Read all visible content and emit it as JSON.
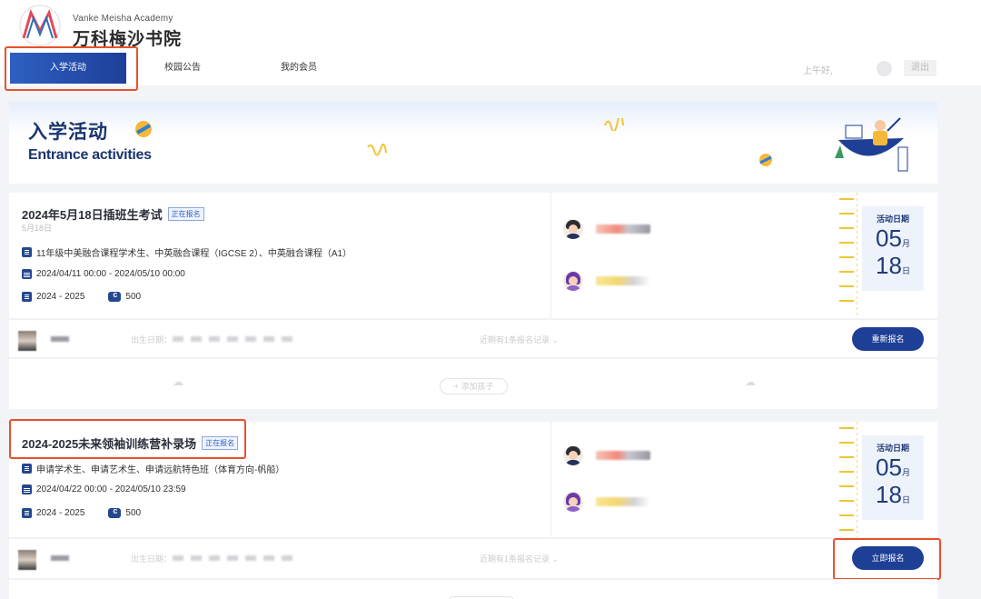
{
  "brand": {
    "en": "Vanke Meisha Academy",
    "cn": "万科梅沙书院"
  },
  "nav": [
    {
      "label": "入学活动",
      "active": true
    },
    {
      "label": "校园公告",
      "active": false
    },
    {
      "label": "我的会员",
      "active": false
    }
  ],
  "header_right": {
    "greeting": "上午好,",
    "logout": "退出"
  },
  "banner": {
    "title_cn": "入学活动",
    "title_en": "Entrance activities"
  },
  "activities": [
    {
      "title": "2024年5月18日插班生考试",
      "status": "正在报名",
      "subtitle": "5月18日",
      "program": "11年级中美融合课程学术生、中英融合课程（IGCSE 2）、中英融合课程（A1）",
      "period": "2024/04/11 00:00 - 2024/05/10 00:00",
      "year": "2024 - 2025",
      "fee": "500",
      "date_label": "活动日期",
      "month": "05",
      "month_unit": "月",
      "day": "18",
      "day_unit": "日",
      "child": {
        "dob_label": "出生日期：",
        "recent": "近期有1条报名记录 ⌄",
        "action": "重新报名"
      },
      "add_child": "+ 添加孩子"
    },
    {
      "title": "2024-2025未来领袖训练营补录场",
      "status": "正在报名",
      "program": "申请学术生、申请艺术生、申请远航特色班（体育方向-帆船）",
      "period": "2024/04/22 00:00 - 2024/05/10 23:59",
      "year": "2024 - 2025",
      "fee": "500",
      "date_label": "活动日期",
      "month": "05",
      "month_unit": "月",
      "day": "18",
      "day_unit": "日",
      "child": {
        "dob_label": "出生日期：",
        "recent": "近期有1条报名记录 ⌄",
        "action": "立即报名"
      }
    }
  ],
  "colors": {
    "primary": "#1e3f96",
    "highlight": "#e8512b",
    "accent_yellow": "#f0c534"
  }
}
